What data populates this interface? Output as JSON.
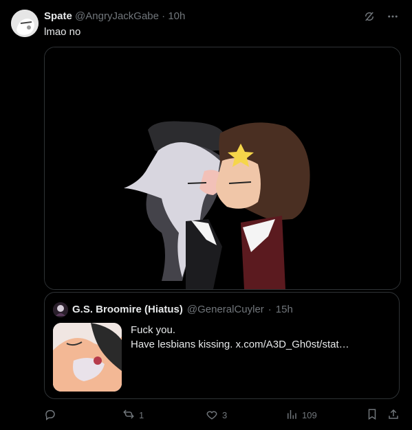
{
  "tweet": {
    "display_name": "Spate",
    "handle": "@AngryJackGabe",
    "separator": "·",
    "time": "10h",
    "text": "lmao no"
  },
  "quote": {
    "display_name": "G.S. Broomire (Hiatus)",
    "handle": "@GeneralCuyler",
    "separator": "·",
    "time": "15h",
    "line1": "Fuck you.",
    "line2": "Have lesbians kissing.  x.com/A3D_Gh0st/stat…"
  },
  "actions": {
    "reply_count": "",
    "retweet_count": "1",
    "like_count": "3",
    "views_count": "109"
  },
  "icons": [
    "grok-icon",
    "more-icon",
    "reply-icon",
    "retweet-icon",
    "like-icon",
    "views-icon",
    "bookmark-icon",
    "share-icon"
  ],
  "colors": {
    "background": "#000000",
    "text": "#e7e9ea",
    "muted": "#71767b",
    "border": "#2f3336"
  }
}
